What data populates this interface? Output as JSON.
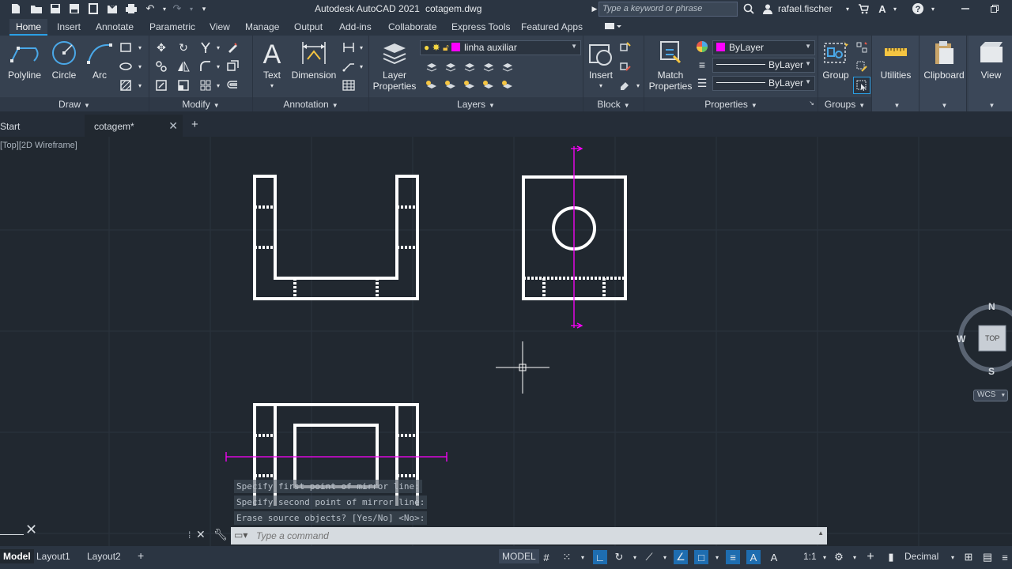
{
  "window": {
    "app_title": "Autodesk AutoCAD 2021",
    "file_title": "cotagem.dwg",
    "search_placeholder": "Type a keyword or phrase",
    "user": "rafael.fischer"
  },
  "ribbon": {
    "tabs": [
      "Home",
      "Insert",
      "Annotate",
      "Parametric",
      "View",
      "Manage",
      "Output",
      "Add-ins",
      "Collaborate",
      "Express Tools",
      "Featured Apps"
    ],
    "active_tab": "Home",
    "panels": {
      "draw": {
        "title": "Draw",
        "polyline": "Polyline",
        "circle": "Circle",
        "arc": "Arc"
      },
      "modify": {
        "title": "Modify"
      },
      "annotation": {
        "title": "Annotation",
        "text": "Text",
        "dimension": "Dimension"
      },
      "layers": {
        "title": "Layers",
        "layer_properties_1": "Layer",
        "layer_properties_2": "Properties",
        "current_layer": "linha auxiliar"
      },
      "block": {
        "title": "Block",
        "insert": "Insert"
      },
      "properties": {
        "title": "Properties",
        "match_1": "Match",
        "match_2": "Properties",
        "color": "ByLayer",
        "linetype": "ByLayer",
        "lineweight": "ByLayer"
      },
      "groups": {
        "title": "Groups",
        "group": "Group"
      },
      "utilities": {
        "title": "Utilities"
      },
      "clipboard": {
        "title": "Clipboard"
      },
      "view": {
        "title": "View"
      }
    },
    "accent_color": "#2aa0e6"
  },
  "file_tabs": {
    "start": "Start",
    "active": "cotagem*",
    "add": "+"
  },
  "canvas": {
    "viewport_label": "[Top][2D Wireframe]",
    "viewcube": {
      "north": "N",
      "south": "S",
      "west": "W",
      "face": "TOP"
    },
    "wcs": "WCS",
    "command_history": [
      "Specify first point of mirror line:",
      "Specify second point of mirror line:",
      "Erase source objects? [Yes/No] <No>:"
    ],
    "mirror_line_color": "#ff00ff"
  },
  "command_line": {
    "placeholder": "Type a command"
  },
  "status_bar": {
    "layouts": [
      "Model",
      "Layout1",
      "Layout2"
    ],
    "add_layout": "+",
    "model_button": "MODEL",
    "annotation_scale": "1:1",
    "units": "Decimal"
  }
}
